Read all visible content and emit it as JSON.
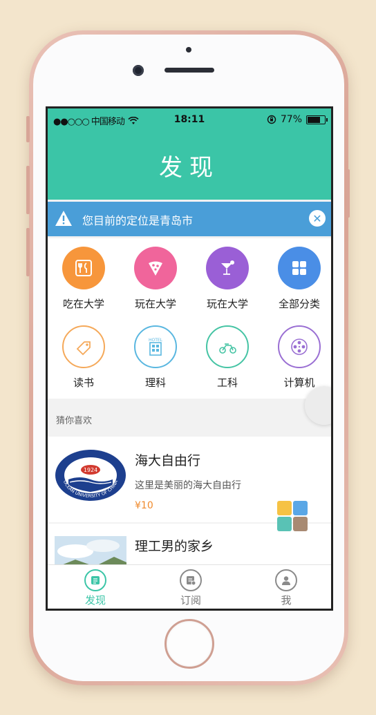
{
  "status": {
    "carrier": "●●○○○ 中国移动",
    "time": "18:11",
    "battery": "77%",
    "battery_level": 0.77
  },
  "header": {
    "title": "发现"
  },
  "location": {
    "message": "您目前的定位是青岛市",
    "close_icon": "close-icon"
  },
  "categories": [
    {
      "label": "吃在大学",
      "icon": "fork-knife-icon",
      "color": "#f7963b"
    },
    {
      "label": "玩在大学",
      "icon": "pizza-icon",
      "color": "#f0659b"
    },
    {
      "label": "玩在大学",
      "icon": "cocktail-icon",
      "color": "#9a5fd6"
    },
    {
      "label": "全部分类",
      "icon": "grid-icon",
      "color": "#4a8ee6"
    },
    {
      "label": "读书",
      "icon": "tag-icon",
      "color": "#f5a95a"
    },
    {
      "label": "理科",
      "icon": "hotel-icon",
      "color": "#5ab7e0"
    },
    {
      "label": "工科",
      "icon": "scooter-icon",
      "color": "#45c4a4"
    },
    {
      "label": "计算机",
      "icon": "film-reel-icon",
      "color": "#9a6fd3"
    }
  ],
  "recommend": {
    "heading": "猜你喜欢"
  },
  "items": [
    {
      "title": "海大自由行",
      "desc": "这里是美丽的海大自由行",
      "price": "¥10",
      "logo_year": "1924",
      "logo_text": "OCEAN UNIVERSITY OF CHINA"
    },
    {
      "title": "理工男的家乡"
    }
  ],
  "tabs": [
    {
      "label": "发现",
      "icon": "discover-icon",
      "active": true
    },
    {
      "label": "订阅",
      "icon": "subscribe-icon",
      "active": false
    },
    {
      "label": "我",
      "icon": "profile-icon",
      "active": false
    }
  ],
  "colors": {
    "primary": "#3bc5a7",
    "banner": "#4a9ed8",
    "price": "#f08a2c"
  }
}
